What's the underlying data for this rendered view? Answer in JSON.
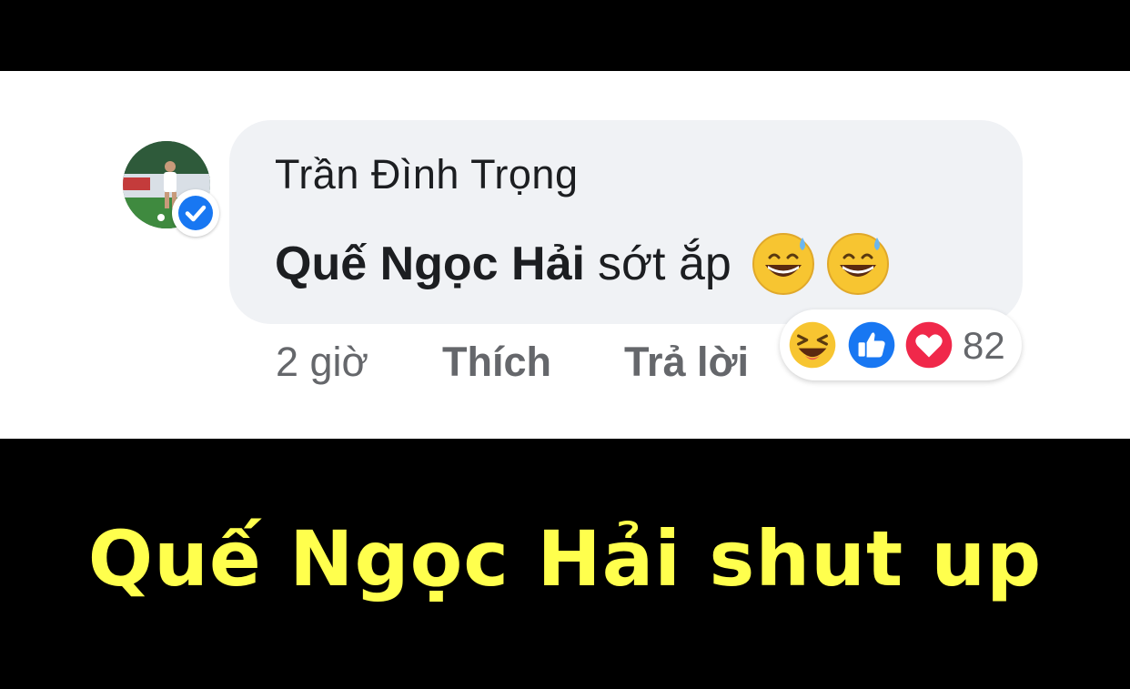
{
  "comment": {
    "author": "Trần Đình Trọng",
    "mention": "Quế Ngọc Hải",
    "text": "sớt ắp",
    "emojis": [
      "grinning-sweat-emoji",
      "grinning-sweat-emoji"
    ],
    "time": "2 giờ",
    "like_label": "Thích",
    "reply_label": "Trả lời",
    "reactions": [
      "haha-reaction-icon",
      "like-reaction-icon",
      "love-reaction-icon"
    ],
    "reaction_count": "82",
    "verified": true
  },
  "caption": "Quế Ngọc Hải shut up",
  "colors": {
    "bubble": "#f0f2f5",
    "caption": "#ffff4d",
    "verified_blue": "#1877f2",
    "meta_text": "#65676b"
  }
}
